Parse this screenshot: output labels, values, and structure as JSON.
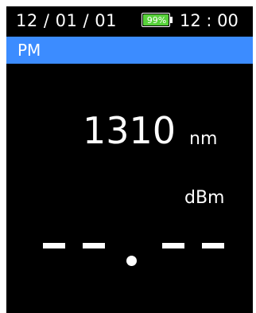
{
  "status": {
    "date": "12 / 01 / 01",
    "battery": {
      "level_text": "99%",
      "level_fraction": 0.99,
      "fill_color": "#57d13a"
    },
    "time": "12 : 00"
  },
  "mode": {
    "label": "PM",
    "bar_color": "#3c8cff"
  },
  "measurement": {
    "wavelength_value": "1310",
    "wavelength_unit": "nm",
    "power_unit": "dBm",
    "power_reading": "- - . - -"
  }
}
